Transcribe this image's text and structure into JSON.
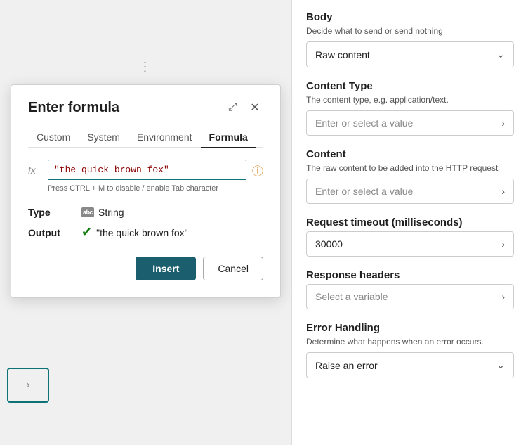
{
  "dialog": {
    "title": "Enter formula",
    "tabs": [
      {
        "id": "custom",
        "label": "Custom"
      },
      {
        "id": "system",
        "label": "System"
      },
      {
        "id": "environment",
        "label": "Environment"
      },
      {
        "id": "formula",
        "label": "Formula"
      }
    ],
    "active_tab": "formula",
    "fx_label": "fx",
    "formula_value": "\"the quick brown fox\"",
    "formula_hint": "Press CTRL + M to disable / enable Tab character",
    "info_icon": "ⓘ",
    "type_label": "Type",
    "type_icon_text": "abc",
    "type_value": "String",
    "output_label": "Output",
    "output_value": "\"the quick brown fox\"",
    "insert_label": "Insert",
    "cancel_label": "Cancel",
    "expand_icon": "⤢",
    "close_icon": "✕"
  },
  "right_panel": {
    "body": {
      "title": "Body",
      "subtitle": "Decide what to send or send nothing",
      "dropdown_value": "Raw content"
    },
    "content_type": {
      "title": "Content Type",
      "subtitle": "The content type, e.g. application/text.",
      "placeholder": "Enter or select a value"
    },
    "content": {
      "title": "Content",
      "subtitle": "The raw content to be added into the HTTP request",
      "placeholder": "Enter or select a value"
    },
    "request_timeout": {
      "title": "Request timeout (milliseconds)",
      "value": "30000"
    },
    "response_headers": {
      "title": "Response headers",
      "placeholder": "Select a variable"
    },
    "error_handling": {
      "title": "Error Handling",
      "subtitle": "Determine what happens when an error occurs.",
      "dropdown_value": "Raise an error"
    }
  }
}
